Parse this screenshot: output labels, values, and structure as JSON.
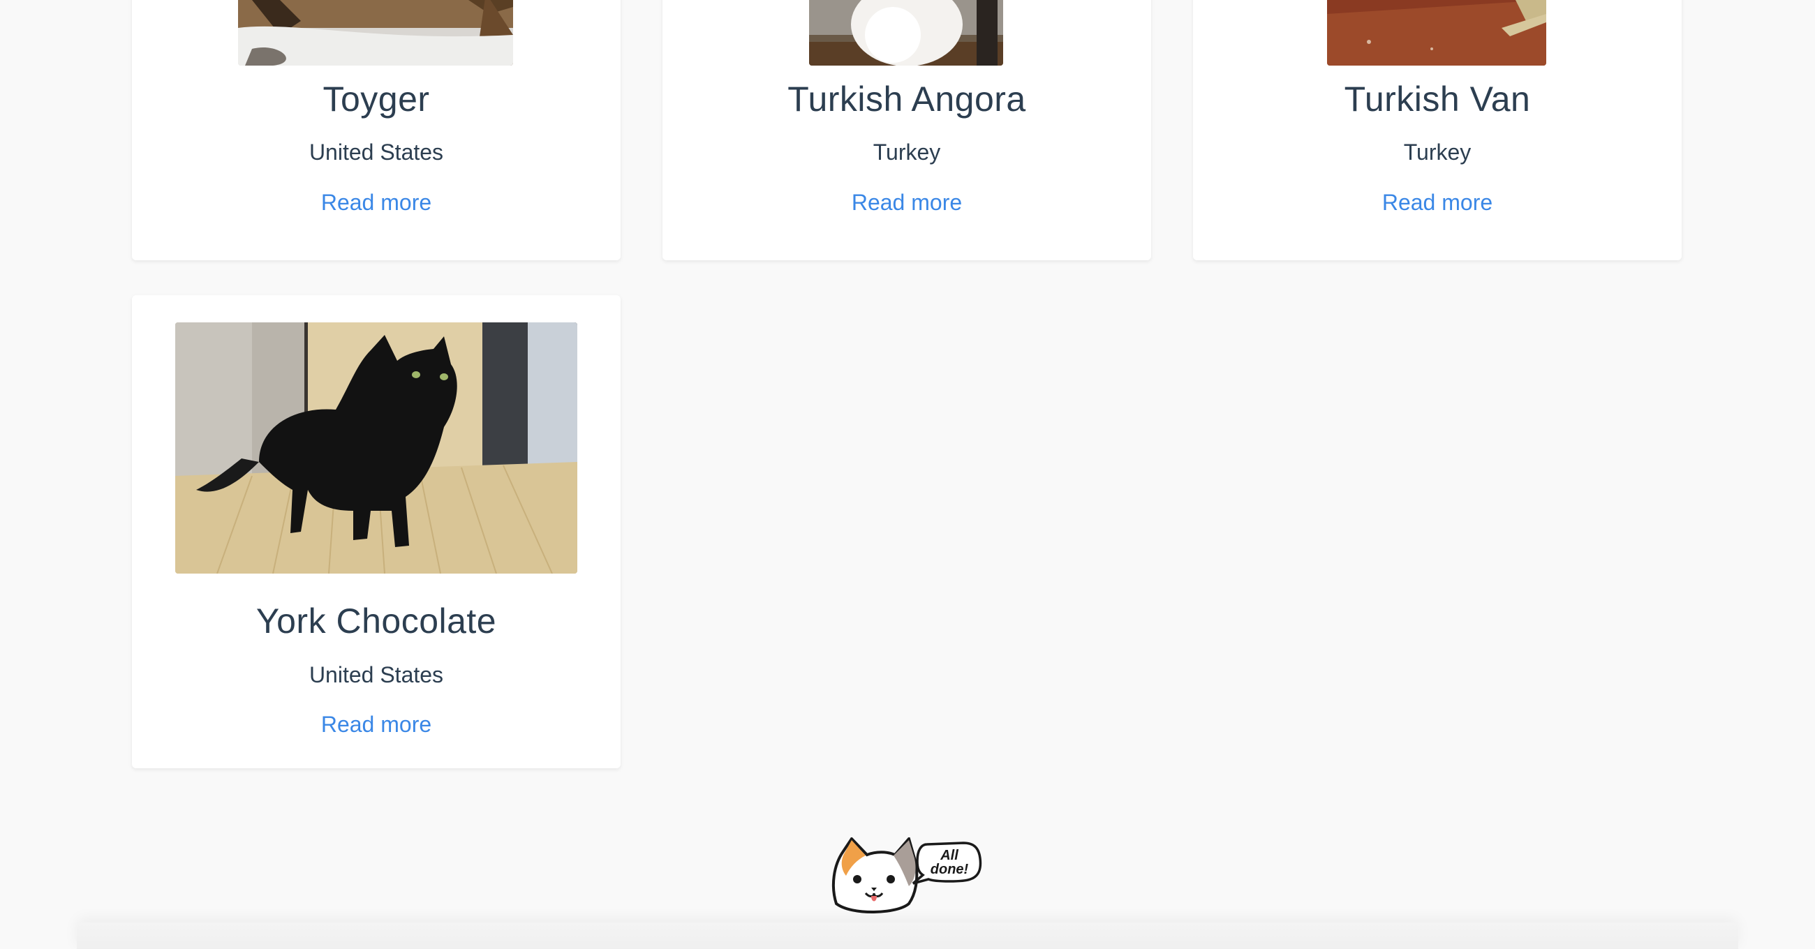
{
  "cards": [
    {
      "title": "Toyger",
      "origin": "United States",
      "link": "Read more"
    },
    {
      "title": "Turkish Angora",
      "origin": "Turkey",
      "link": "Read more"
    },
    {
      "title": "Turkish Van",
      "origin": "Turkey",
      "link": "Read more"
    },
    {
      "title": "York Chocolate",
      "origin": "United States",
      "link": "Read more"
    }
  ],
  "footer": {
    "bubble_text_line1": "All",
    "bubble_text_line2": "done!"
  },
  "colors": {
    "background": "#f9f9f9",
    "card": "#ffffff",
    "text": "#2c3e50",
    "link": "#3a87e6"
  },
  "icons": {
    "mascot": "calico-cat-face-icon",
    "bubble": "speech-bubble-icon"
  }
}
